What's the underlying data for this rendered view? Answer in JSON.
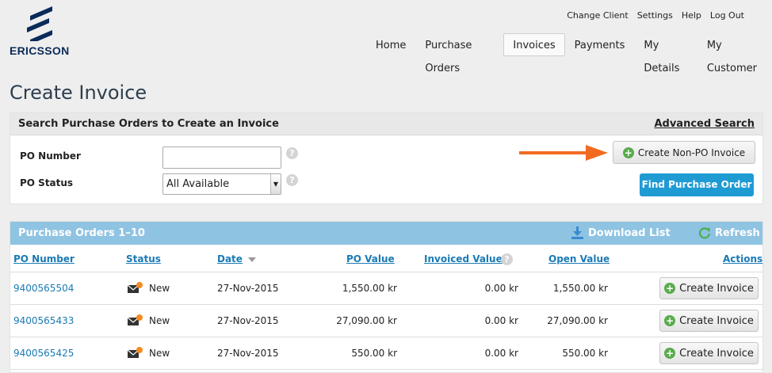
{
  "brand": {
    "name": "ERICSSON"
  },
  "util_links": [
    "Change Client",
    "Settings",
    "Help",
    "Log Out"
  ],
  "nav": {
    "items": [
      "Home",
      "Purchase Orders",
      "Invoices",
      "Payments",
      "My Details",
      "My Customer"
    ],
    "active": "Invoices"
  },
  "page": {
    "title": "Create Invoice"
  },
  "search": {
    "title": "Search Purchase Orders to Create an Invoice",
    "advanced": "Advanced Search",
    "po_number_label": "PO Number",
    "po_number_value": "",
    "po_status_label": "PO Status",
    "po_status_value": "All Available",
    "help": "?",
    "create_non_po": "Create Non-PO Invoice",
    "find": "Find Purchase Order"
  },
  "orders": {
    "title": "Purchase Orders 1–10",
    "download": "Download List",
    "refresh": "Refresh",
    "columns": {
      "po_number": "PO Number",
      "status": "Status",
      "date": "Date",
      "po_value": "PO Value",
      "invoiced_value": "Invoiced Value",
      "open_value": "Open Value",
      "actions": "Actions"
    },
    "rows": [
      {
        "po": "9400565504",
        "status": "New",
        "date": "27-Nov-2015",
        "po_value": "1,550.00 kr",
        "invoiced": "0.00 kr",
        "open": "1,550.00 kr",
        "action": "Create Invoice"
      },
      {
        "po": "9400565433",
        "status": "New",
        "date": "27-Nov-2015",
        "po_value": "27,090.00 kr",
        "invoiced": "0.00 kr",
        "open": "27,090.00 kr",
        "action": "Create Invoice"
      },
      {
        "po": "9400565425",
        "status": "New",
        "date": "27-Nov-2015",
        "po_value": "550.00 kr",
        "invoiced": "0.00 kr",
        "open": "550.00 kr",
        "action": "Create Invoice"
      }
    ]
  },
  "colors": {
    "accent_blue": "#1f9bd4",
    "header_blue": "#8fc3e2",
    "link_blue": "#1a7ab5",
    "arrow_orange": "#f26a21",
    "plus_green": "#5aab4e"
  }
}
